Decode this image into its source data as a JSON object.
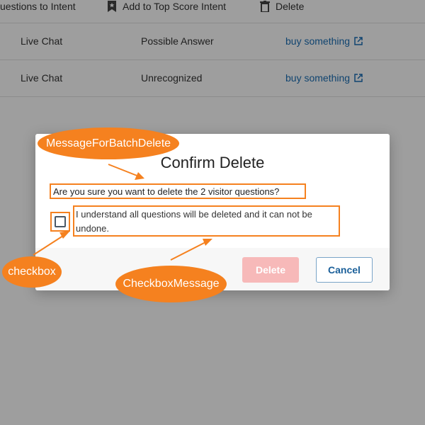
{
  "toolbar": {
    "move_label": "uestions to Intent",
    "add_label": "Add to Top Score Intent",
    "delete_label": "Delete"
  },
  "rows": [
    {
      "channel": "Live Chat",
      "status": "Possible Answer",
      "link": "buy something"
    },
    {
      "channel": "Live Chat",
      "status": "Unrecognized",
      "link": "buy something"
    }
  ],
  "modal": {
    "title": "Confirm Delete",
    "question": "Are you sure you want to delete the 2 visitor questions?",
    "checkbox_message": "I understand all questions will be deleted and it can not be undone.",
    "delete_label": "Delete",
    "cancel_label": "Cancel"
  },
  "annotations": {
    "batch_message": "MessageForBatchDelete",
    "checkbox": "checkbox",
    "checkbox_message": "CheckboxMessage",
    "color": "#f5811f"
  }
}
